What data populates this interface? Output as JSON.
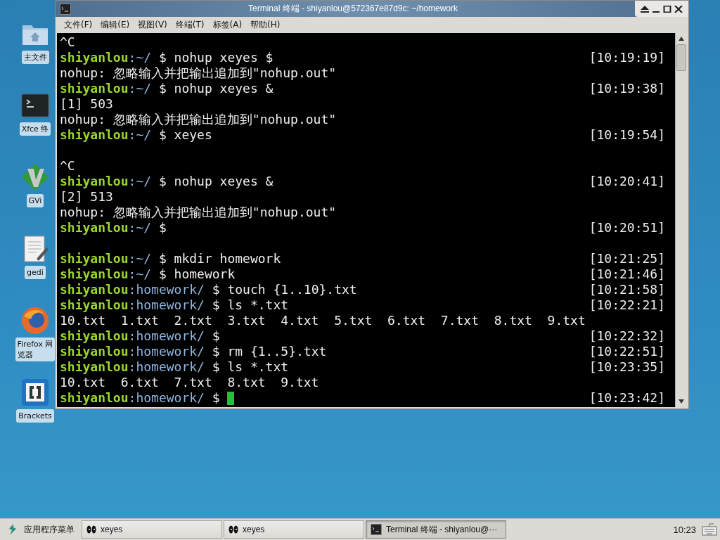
{
  "desktop_icons": [
    {
      "kind": "folder",
      "label_lines": [
        "主文件"
      ]
    },
    {
      "kind": "terminal",
      "label_lines": [
        "Xfce 终"
      ]
    },
    {
      "kind": "diamond",
      "label_lines": [
        "GVi"
      ]
    },
    {
      "kind": "notepad",
      "label_lines": [
        "gedi"
      ]
    },
    {
      "kind": "globe",
      "label_lines": [
        "Firefox 网",
        "览器"
      ]
    },
    {
      "kind": "brackets",
      "label_lines": [
        "Brackets"
      ]
    }
  ],
  "window": {
    "title": "Terminal 终端 - shiyanlou@572367e87d9c: ~/homework",
    "menu": [
      "文件(F)",
      "编辑(E)",
      "视图(V)",
      "终端(T)",
      "标签(A)",
      "帮助(H)"
    ],
    "lines": [
      {
        "kind": "output",
        "text": "^C"
      },
      {
        "kind": "prompt",
        "user": "shiyanlou",
        "path": ":~/",
        "command": " $ nohup xeyes $",
        "time": "[10:19:19]",
        "cursor": false
      },
      {
        "kind": "output",
        "text": "nohup: 忽略输入并把输出追加到\"nohup.out\""
      },
      {
        "kind": "prompt",
        "user": "shiyanlou",
        "path": ":~/",
        "command": " $ nohup xeyes &",
        "time": "[10:19:38]",
        "cursor": false
      },
      {
        "kind": "output",
        "text": "[1] 503"
      },
      {
        "kind": "output",
        "text": "nohup: 忽略输入并把输出追加到\"nohup.out\""
      },
      {
        "kind": "prompt",
        "user": "shiyanlou",
        "path": ":~/",
        "command": " $ xeyes",
        "time": "[10:19:54]",
        "cursor": false
      },
      {
        "kind": "blank"
      },
      {
        "kind": "output",
        "text": "^C"
      },
      {
        "kind": "prompt",
        "user": "shiyanlou",
        "path": ":~/",
        "command": " $ nohup xeyes &",
        "time": "[10:20:41]",
        "cursor": false
      },
      {
        "kind": "output",
        "text": "[2] 513"
      },
      {
        "kind": "output",
        "text": "nohup: 忽略输入并把输出追加到\"nohup.out\""
      },
      {
        "kind": "prompt",
        "user": "shiyanlou",
        "path": ":~/",
        "command": " $",
        "time": "[10:20:51]",
        "cursor": false
      },
      {
        "kind": "blank"
      },
      {
        "kind": "prompt",
        "user": "shiyanlou",
        "path": ":~/",
        "command": " $ mkdir homework",
        "time": "[10:21:25]",
        "cursor": false
      },
      {
        "kind": "prompt",
        "user": "shiyanlou",
        "path": ":~/",
        "command": " $ homework",
        "time": "[10:21:46]",
        "cursor": false
      },
      {
        "kind": "prompt",
        "user": "shiyanlou",
        "path": ":homework/",
        "command": " $ touch {1..10}.txt",
        "time": "[10:21:58]",
        "cursor": false
      },
      {
        "kind": "prompt",
        "user": "shiyanlou",
        "path": ":homework/",
        "command": " $ ls *.txt",
        "time": "[10:22:21]",
        "cursor": false
      },
      {
        "kind": "output",
        "text": "10.txt  1.txt  2.txt  3.txt  4.txt  5.txt  6.txt  7.txt  8.txt  9.txt"
      },
      {
        "kind": "prompt",
        "user": "shiyanlou",
        "path": ":homework/",
        "command": " $",
        "time": "[10:22:32]",
        "cursor": false
      },
      {
        "kind": "prompt",
        "user": "shiyanlou",
        "path": ":homework/",
        "command": " $ rm {1..5}.txt",
        "time": "[10:22:51]",
        "cursor": false
      },
      {
        "kind": "prompt",
        "user": "shiyanlou",
        "path": ":homework/",
        "command": " $ ls *.txt",
        "time": "[10:23:35]",
        "cursor": false
      },
      {
        "kind": "output",
        "text": "10.txt  6.txt  7.txt  8.txt  9.txt"
      },
      {
        "kind": "prompt",
        "user": "shiyanlou",
        "path": ":homework/",
        "command": " $ ",
        "time": "[10:23:42]",
        "cursor": true
      }
    ]
  },
  "taskbar": {
    "menu_label": "应用程序菜单",
    "tasks": [
      {
        "kind": "eyes",
        "label": "xeyes",
        "selected": false
      },
      {
        "kind": "eyes",
        "label": "xeyes",
        "selected": false
      },
      {
        "kind": "terminal",
        "label": "Terminal 终端 - shiyanlou@···",
        "selected": true
      }
    ],
    "clock": "10:23"
  }
}
